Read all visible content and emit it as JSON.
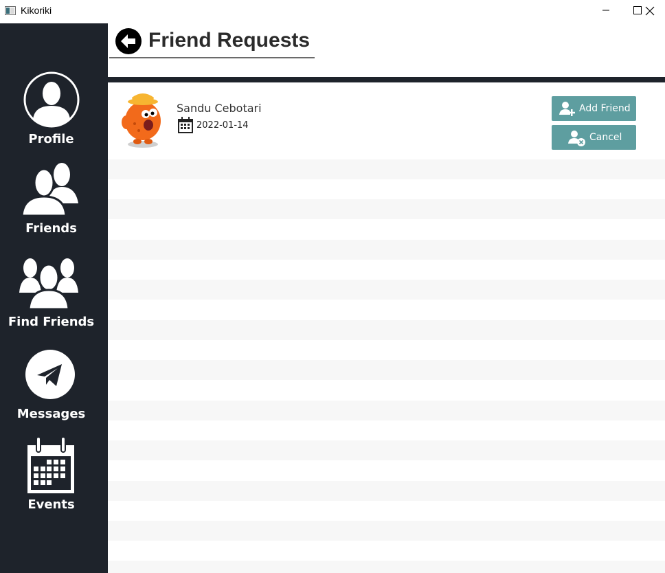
{
  "window": {
    "title": "Kikoriki"
  },
  "sidebar": {
    "items": [
      {
        "label": "Profile",
        "icon": "profile-icon"
      },
      {
        "label": "Friends",
        "icon": "friends-icon"
      },
      {
        "label": "Find Friends",
        "icon": "find-friends-icon"
      },
      {
        "label": "Messages",
        "icon": "messages-icon"
      },
      {
        "label": "Events",
        "icon": "calendar-icon"
      }
    ]
  },
  "header": {
    "title": "Friend Requests",
    "back_icon": "back-arrow-icon"
  },
  "requests": [
    {
      "name": "Sandu Cebotari",
      "date": "2022-01-14",
      "add_label": "Add Friend",
      "cancel_label": "Cancel"
    }
  ],
  "colors": {
    "sidebar_bg": "#1e232b",
    "button_bg": "#5e9ea0",
    "stripe": "#f7f7f7"
  }
}
